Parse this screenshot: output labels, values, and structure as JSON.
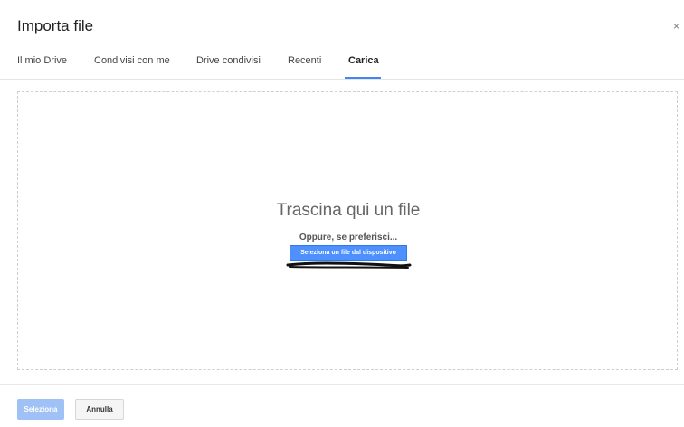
{
  "dialog": {
    "title": "Importa file",
    "close_label": "×"
  },
  "tabs": [
    {
      "label": "Il mio Drive",
      "active": false
    },
    {
      "label": "Condivisi con me",
      "active": false
    },
    {
      "label": "Drive condivisi",
      "active": false
    },
    {
      "label": "Recenti",
      "active": false
    },
    {
      "label": "Carica",
      "active": true
    }
  ],
  "upload": {
    "drop_title": "Trascina qui un file",
    "or_text": "Oppure, se preferisci...",
    "select_button": "Seleziona un file dal dispositivo"
  },
  "footer": {
    "select_button": "Seleziona",
    "cancel_button": "Annulla"
  },
  "colors": {
    "accent": "#4285f4",
    "primary_button": "#4d90fe",
    "disabled_button": "#9fc1f6"
  }
}
